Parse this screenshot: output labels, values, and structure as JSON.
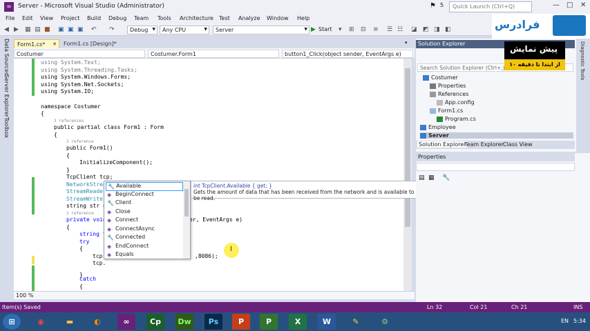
{
  "window": {
    "title": "Server - Microsoft Visual Studio (Administrator)",
    "quick_launch_placeholder": "Quick Launch (Ctrl+Q)",
    "notif_count": "5"
  },
  "menu": [
    "File",
    "Edit",
    "View",
    "Project",
    "Build",
    "Debug",
    "Team",
    "Tools",
    "Architecture",
    "Test",
    "Analyze",
    "Window",
    "Help"
  ],
  "toolbar": {
    "config": "Debug",
    "platform": "Any CPU",
    "project": "Server",
    "start_label": "Start"
  },
  "brand": {
    "logo_text": "فرادرس",
    "accent": "#1b76c0"
  },
  "left_rail": [
    "Data Sources",
    "Server Explorer",
    "Toolbox"
  ],
  "editor": {
    "tabs": [
      "Form1.cs*",
      "Form1.cs [Design]*"
    ],
    "nav": [
      "Costumer",
      "Costumer.Form1",
      "button1_Click(object sender, EventArgs e)"
    ],
    "zoom": "100 %"
  },
  "code": {
    "l1": "using System.Text;",
    "l2": "using System.Threading.Tasks;",
    "l3": "using System.Windows.Forms;",
    "l4": "using System.Net.Sockets;",
    "l5": "using System.IO;",
    "ns": "namespace Costumer",
    "ob": "{",
    "refs3": "3 references",
    "cls": "public partial class Form1 : Form",
    "ob2": "{",
    "ref1": "1 reference",
    "ctor": "public Form1()",
    "ob3": "{",
    "init": "InitializeComponent();",
    "cb3": "}",
    "f1": "TcpClient tcp;",
    "f2": "NetworkStrea",
    "f3": "StreamReader",
    "f4": "StreamWriter",
    "f5": "string str =",
    "ref1b": "1 reference",
    "m": "private void",
    "mtail": "er, EventArgs e)",
    "ob4": "{",
    "s1": "string t",
    "try": "try",
    "ob5": "{",
    "tcp1": "tcp",
    "tcp1tail": ",8086);",
    "tcp2": "tcp.",
    "cb5": "}",
    "catch": "catch",
    "ob6": "{"
  },
  "intellisense": {
    "items": [
      "Available",
      "BeginConnect",
      "Client",
      "Close",
      "Connect",
      "ConnectAsync",
      "Connected",
      "EndConnect",
      "Equals"
    ],
    "tip_sig": "int TcpClient.Available { get; }",
    "tip_desc": "Gets the amount of data that has been received from the network and is available to be read."
  },
  "solution_explorer": {
    "title": "Solution Explorer",
    "search_placeholder": "Search Solution Explorer (Ctrl+;)",
    "tree": [
      "Costumer",
      "Properties",
      "References",
      "App.config",
      "Form1.cs",
      "Program.cs",
      "Employee",
      "Server"
    ],
    "tabs": [
      "Solution Explorer",
      "Team Explorer",
      "Class View"
    ]
  },
  "promo": {
    "main": "پیش نمایش",
    "sub": "از ابتدا تا دقیقه ۱۰"
  },
  "properties": {
    "title": "Properties"
  },
  "right_rail": [
    "Diagnostic Tools"
  ],
  "status": {
    "msg": "Item(s) Saved",
    "ln": "Ln 32",
    "col": "Col 21",
    "ch": "Ch 21",
    "ins": "INS"
  },
  "taskbar": {
    "lang": "EN",
    "time": "5:34"
  }
}
